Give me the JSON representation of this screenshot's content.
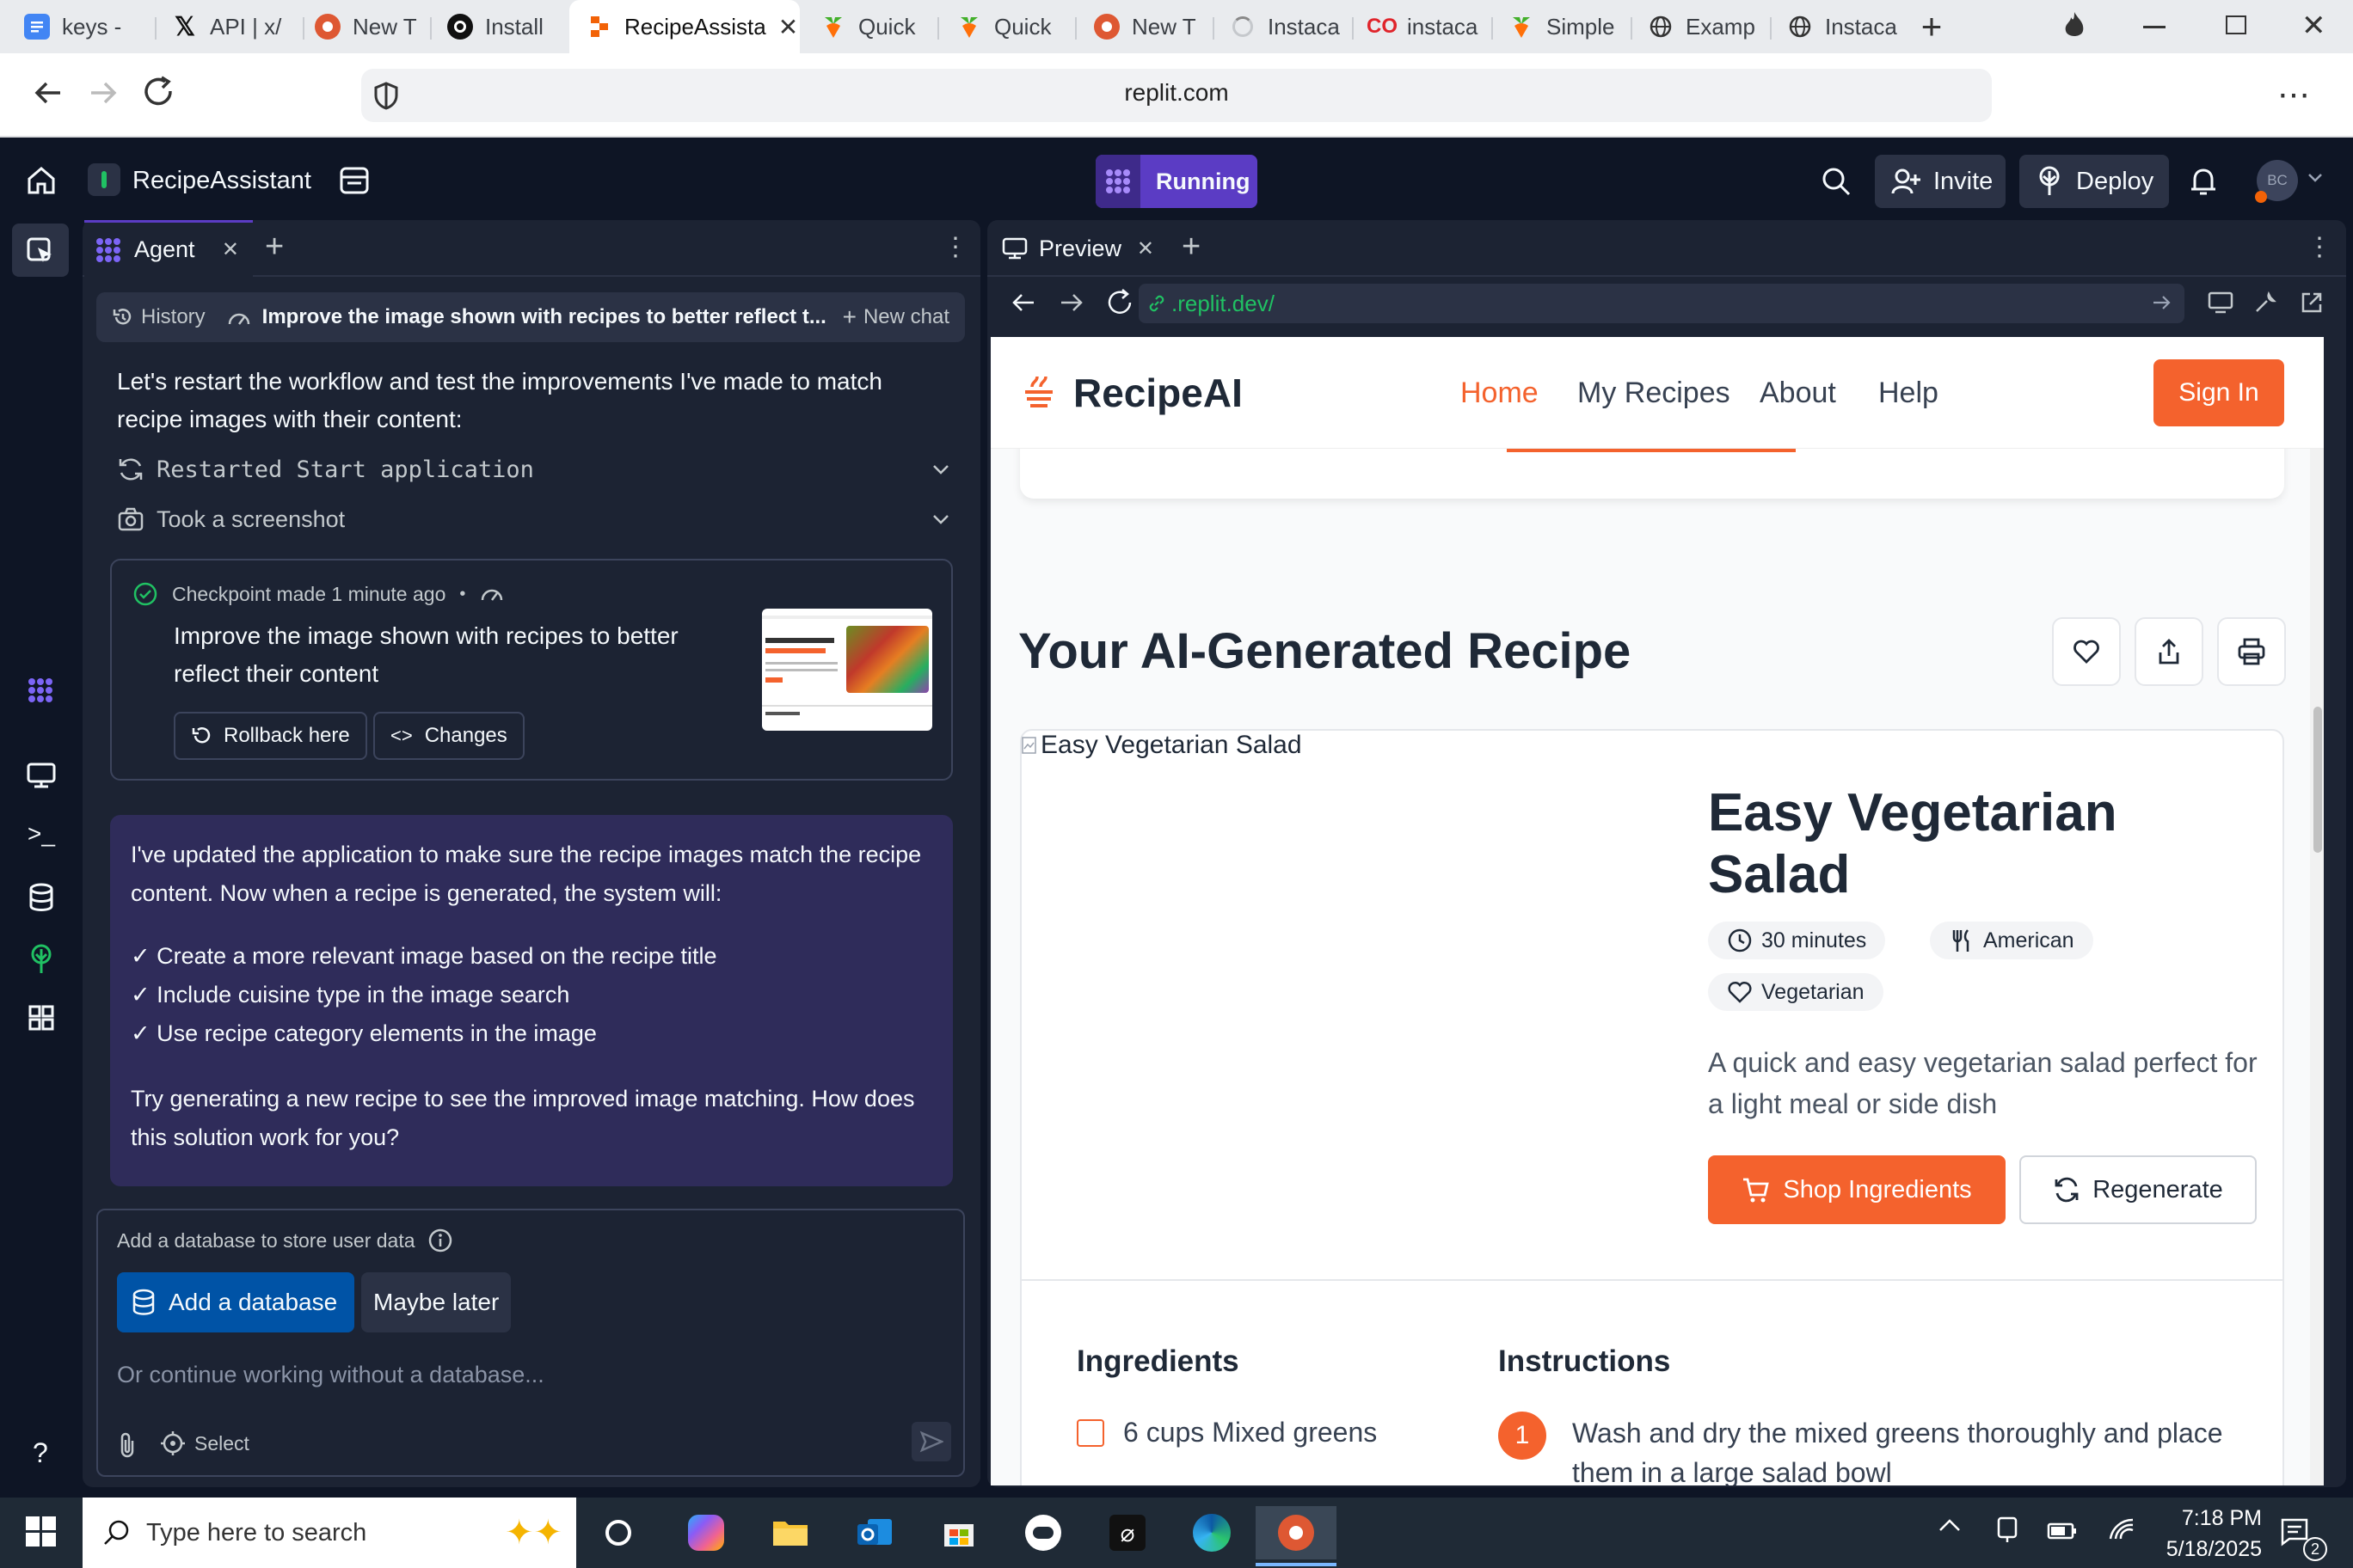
{
  "browser": {
    "tabs": [
      {
        "label": "keys -",
        "icon": "docs-icon"
      },
      {
        "label": "API | x/",
        "icon": "x-icon"
      },
      {
        "label": "New T",
        "icon": "duckduckgo-icon"
      },
      {
        "label": "Install",
        "icon": "openai-icon"
      },
      {
        "label": "RecipeAssista",
        "icon": "replit-icon"
      },
      {
        "label": "Quick",
        "icon": "instacart-icon"
      },
      {
        "label": "Quick",
        "icon": "instacart-icon"
      },
      {
        "label": "New T",
        "icon": "duckduckgo-icon"
      },
      {
        "label": "Instaca",
        "icon": "loading-icon"
      },
      {
        "label": "instaca",
        "icon": "co-icon"
      },
      {
        "label": "Simple",
        "icon": "instacart-icon"
      },
      {
        "label": "Examp",
        "icon": "globe-icon"
      },
      {
        "label": "Instaca",
        "icon": "globe-icon"
      }
    ],
    "url": "replit.com"
  },
  "replit": {
    "project_name": "RecipeAssistant",
    "run_status": "Running",
    "invite_label": "Invite",
    "deploy_label": "Deploy",
    "avatar_initials": "BC",
    "accent": "#5b3cc4"
  },
  "agent": {
    "tab_label": "Agent",
    "history_label": "History",
    "chat_title": "Improve the image shown with recipes to better reflect t...",
    "new_chat_label": "New chat",
    "intro_message": "Let's restart the workflow and test the improvements I've made to match recipe images with their content:",
    "actions": [
      {
        "label": "Restarted Start application",
        "icon": "restart-icon"
      },
      {
        "label": "Took a screenshot",
        "icon": "camera-icon"
      }
    ],
    "checkpoint": {
      "header": "Checkpoint made 1 minute ago",
      "description": "Improve the image shown with recipes to better reflect their content",
      "rollback_label": "Rollback here",
      "changes_label": "Changes"
    },
    "response": {
      "p1": "I've updated the application to make sure the recipe images match the recipe content. Now when a recipe is generated, the system will:",
      "bullets": [
        "✓ Create a more relevant image based on the recipe title",
        "✓ Include cuisine type in the image search",
        "✓ Use recipe category elements in the image"
      ],
      "p2": "Try generating a new recipe to see the improved image matching. How does this solution work for you?"
    },
    "db_prompt": {
      "text": "Add a database to store user data",
      "add_label": "Add a database",
      "later_label": "Maybe later"
    },
    "input_placeholder": "Or continue working without a database...",
    "select_label": "Select"
  },
  "preview": {
    "tab_label": "Preview",
    "url": ".replit.dev/"
  },
  "recipe_app": {
    "brand": "RecipeAI",
    "nav": [
      "Home",
      "My Recipes",
      "About",
      "Help"
    ],
    "sign_in": "Sign In",
    "section_title": "Your AI-Generated Recipe",
    "image_alt": "Easy Vegetarian Salad",
    "recipe_title": "Easy Vegetarian Salad",
    "tags": [
      {
        "label": "30 minutes",
        "icon": "clock-icon"
      },
      {
        "label": "American",
        "icon": "utensils-icon"
      },
      {
        "label": "Vegetarian",
        "icon": "heart-icon"
      }
    ],
    "description": "A quick and easy vegetarian salad perfect for a light meal or side dish",
    "shop_label": "Shop Ingredients",
    "regenerate_label": "Regenerate",
    "ingredients_title": "Ingredients",
    "instructions_title": "Instructions",
    "ingredients": [
      "6 cups Mixed greens"
    ],
    "instructions": [
      {
        "num": "1",
        "text": "Wash and dry the mixed greens thoroughly and place them in a large salad bowl"
      }
    ],
    "accent": "#f4622d"
  },
  "taskbar": {
    "search_placeholder": "Type here to search",
    "time": "7:18 PM",
    "date": "5/18/2025",
    "notifications": "2"
  }
}
